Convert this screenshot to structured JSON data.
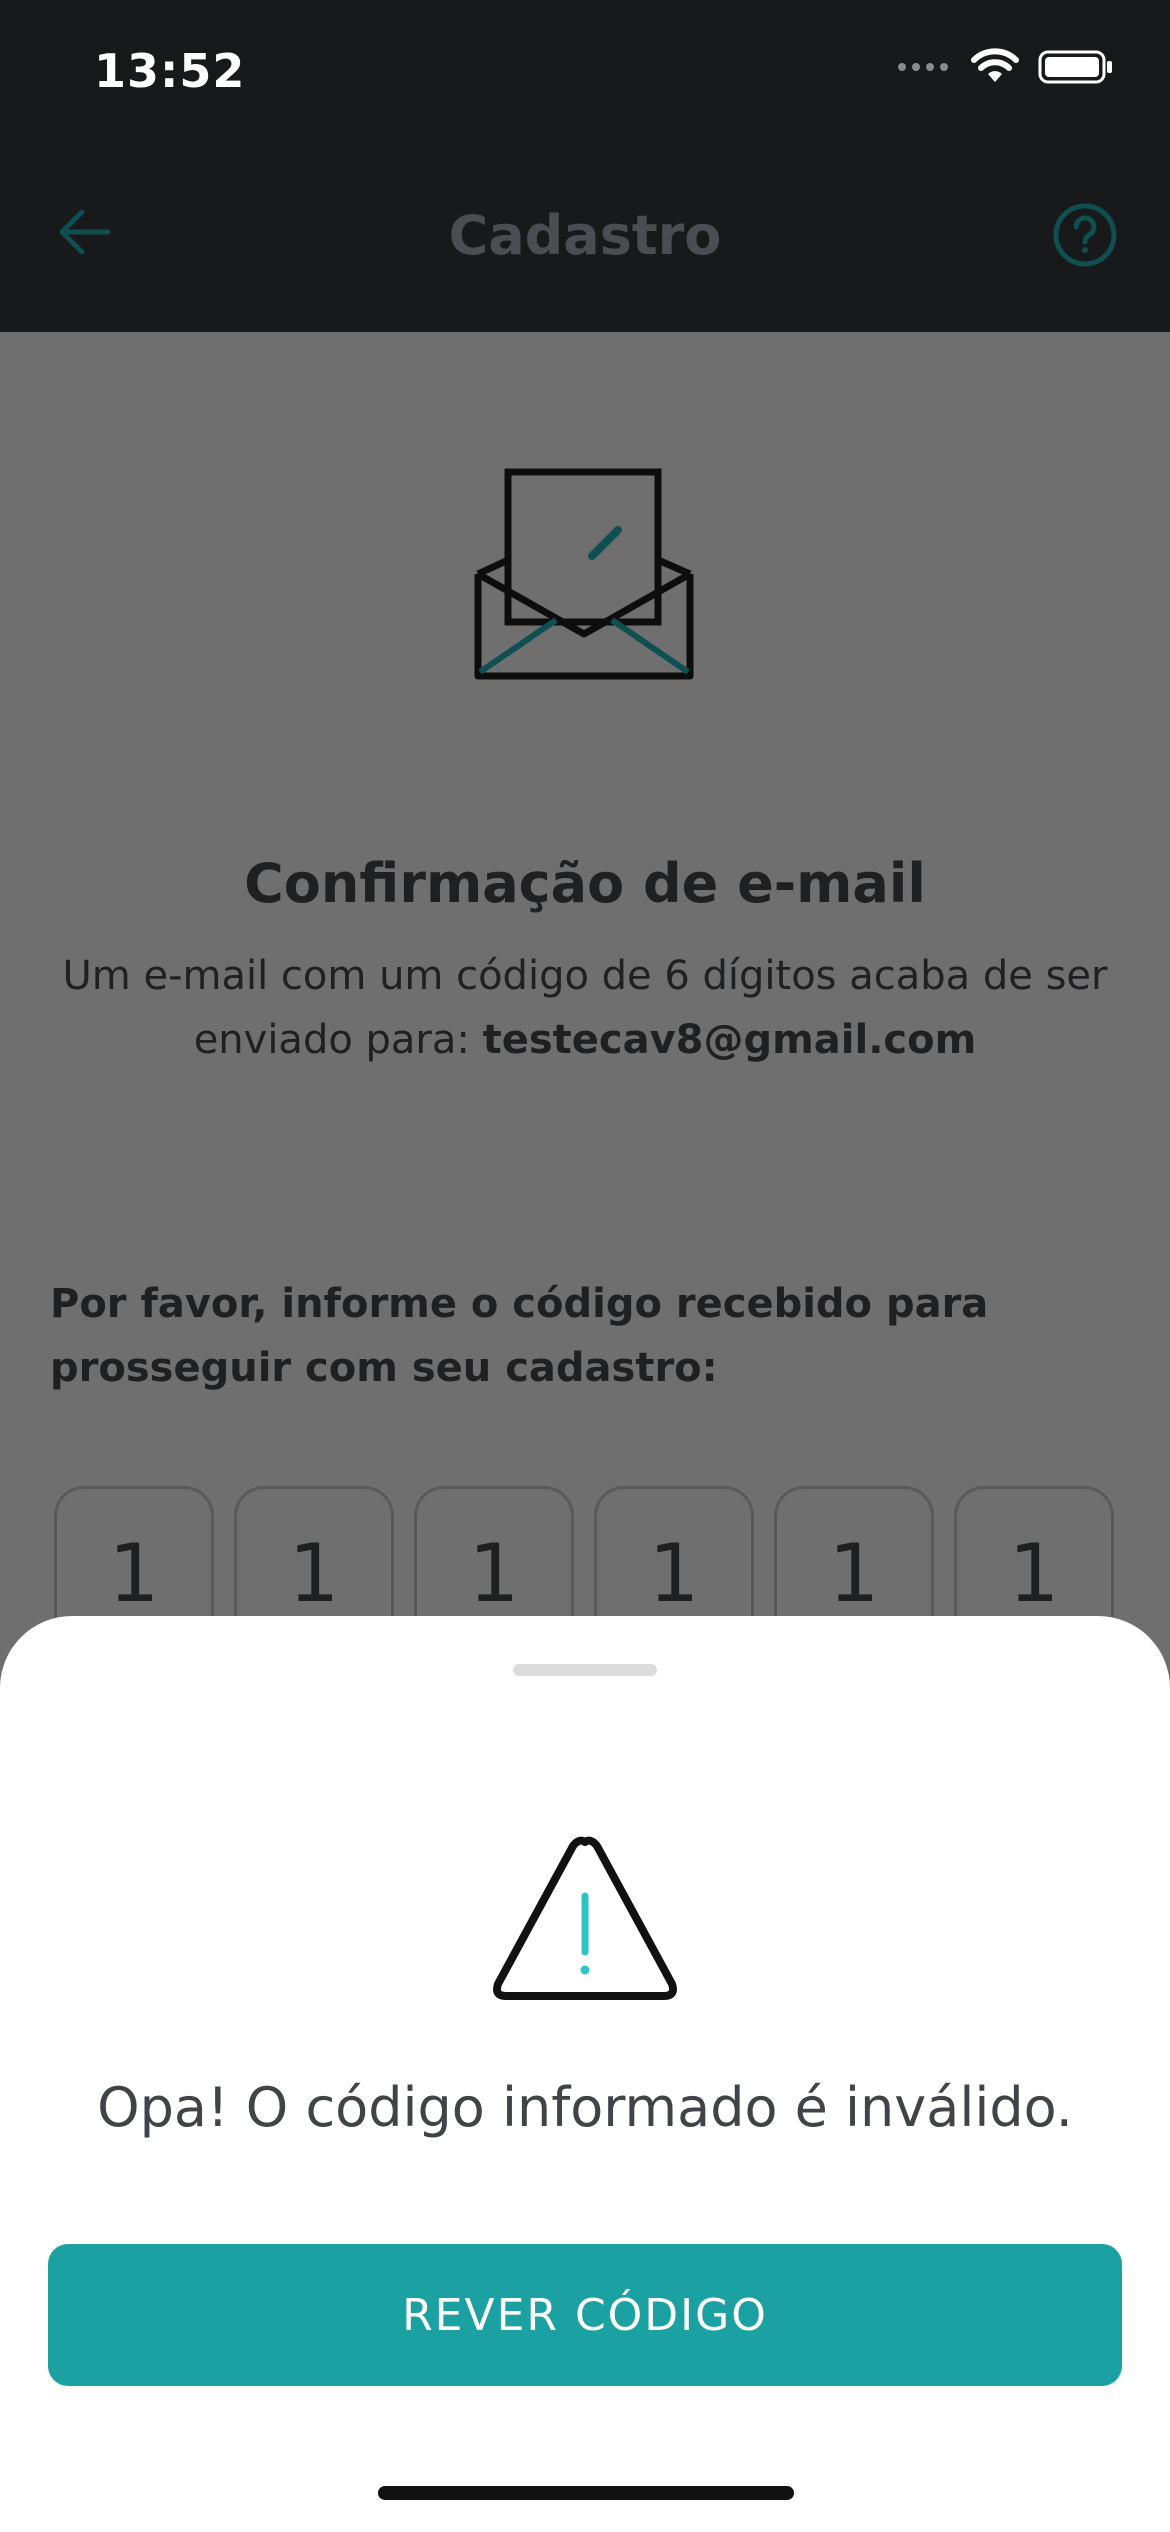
{
  "status_bar": {
    "time": "13:52",
    "icons": [
      "signal-dots-icon",
      "wifi-icon",
      "battery-icon"
    ]
  },
  "nav": {
    "title": "Cadastro",
    "back_icon": "arrow-left-icon",
    "help_icon": "help-circle-icon"
  },
  "content": {
    "title": "Confirmação de e-mail",
    "description_prefix": "Um e-mail com um código de 6 dígitos acaba de ser enviado para: ",
    "email": "testecav8@gmail.com",
    "instruction": "Por favor, informe o código recebido para prosseguir com seu cadastro:",
    "code_digits": [
      "1",
      "1",
      "1",
      "1",
      "1",
      "1"
    ]
  },
  "sheet": {
    "message": "Opa! O código informado é inválido.",
    "button_label": "REVER CÓDIGO"
  },
  "colors": {
    "accent": "#1ba1a2",
    "overlay_bg": "#6f6f6f",
    "dark_bar": "#18191b"
  }
}
